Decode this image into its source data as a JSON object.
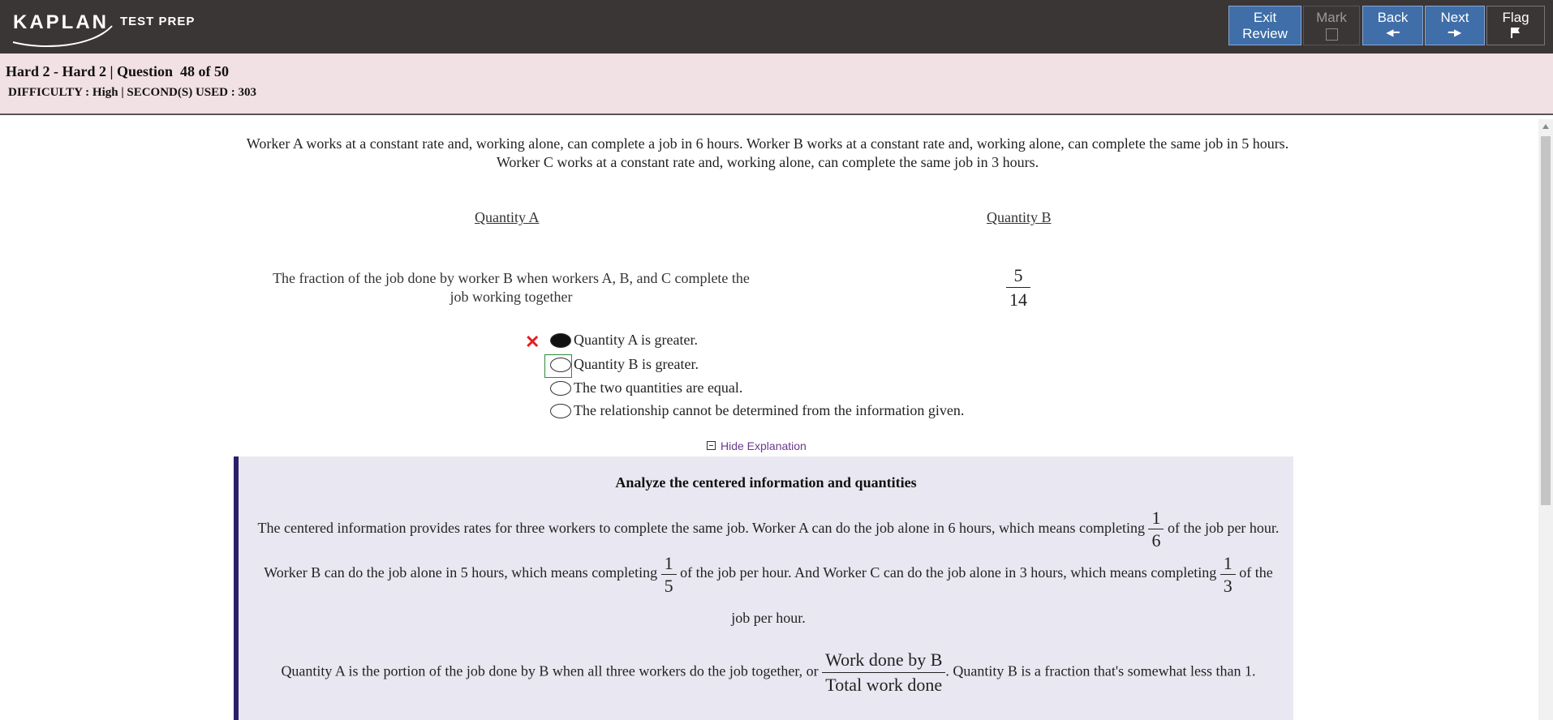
{
  "header": {
    "logo_brand": "KAPLAN",
    "logo_sub": "TEST PREP",
    "buttons": {
      "exit_line1": "Exit",
      "exit_line2": "Review",
      "mark": "Mark",
      "back": "Back",
      "next": "Next",
      "flag": "Flag"
    }
  },
  "info": {
    "title": "Hard 2 - Hard 2 | Question  48 of 50",
    "meta": "DIFFICULTY : High | SECOND(S) USED : 303"
  },
  "question": {
    "stem": "Worker A works at a constant rate and, working alone, can complete a job in 6 hours. Worker B works at a constant rate and, working alone, can complete the same job in 5 hours. Worker C works at a constant rate and, working alone, can complete the same job in 3 hours.",
    "quantity_a_label": "Quantity A",
    "quantity_b_label": "Quantity B",
    "quantity_a_text": "The fraction of the job done by worker B when workers A, B, and C complete the job working together",
    "quantity_b_num": "5",
    "quantity_b_den": "14",
    "incorrect_mark": "✕",
    "options": [
      "Quantity A is greater.",
      "Quantity B is greater.",
      "The two quantities are equal.",
      "The relationship cannot be determined from the information given."
    ],
    "selected_index": 0
  },
  "explanation": {
    "toggle_label": "Hide Explanation",
    "title": "Analyze the centered information and quantities",
    "p1_a": "The centered information provides rates for three workers to complete the same job. Worker A can do the job alone in 6 hours, which means completing",
    "f1_num": "1",
    "f1_den": "6",
    "p1_b": "of the job per hour. Worker B can do the job alone in 5 hours, which means completing",
    "f2_num": "1",
    "f2_den": "5",
    "p1_c": "of the job per hour. And Worker C can do the job alone in 3 hours, which means completing",
    "f3_num": "1",
    "f3_den": "3",
    "p1_d": "of the job per hour.",
    "p2_a": "Quantity A is the portion of the job done by B when all three workers do the job together, or",
    "f4_num": "Work done by B",
    "f4_den": "Total work done",
    "p2_b": ". Quantity B is a fraction that's somewhat less than 1."
  }
}
